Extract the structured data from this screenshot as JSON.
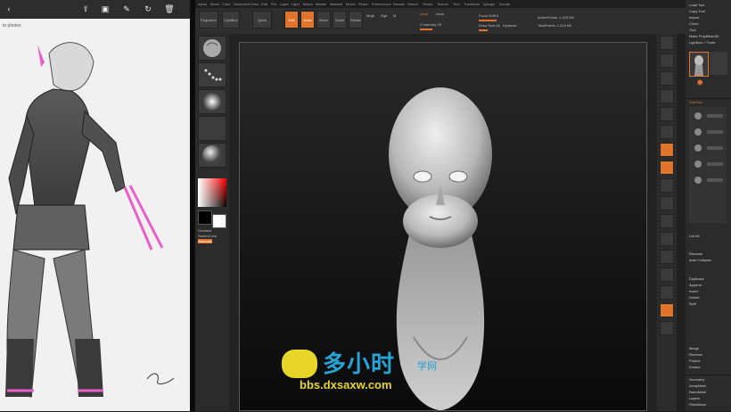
{
  "viewer": {
    "title": "to photos",
    "icons": [
      "back-icon",
      "share-icon",
      "slideshow-icon",
      "edit-icon",
      "rotate-icon",
      "delete-icon"
    ]
  },
  "zbrush": {
    "menu": [
      "Alpha",
      "Brush",
      "Color",
      "Document",
      "Draw",
      "Edit",
      "File",
      "Layer",
      "Light",
      "Macro",
      "Marker",
      "Material",
      "Movie",
      "Picker",
      "Preferences",
      "Render",
      "Stencil",
      "Stroke",
      "Texture",
      "Tool",
      "Transform",
      "Zplugin",
      "Zscript"
    ],
    "top_buttons": [
      "Projection Master",
      "LightBox",
      "Quick Sketch",
      "Edit",
      "Draw",
      "Move",
      "Scale",
      "Rotate"
    ],
    "mrgb": "Mrgb",
    "rgb": "Rgb",
    "m": "M",
    "zadd": "Zadd",
    "zsub": "Zsub",
    "z_intensity": "Z Intensity 25",
    "focal_shift": "Focal Shift 0",
    "draw_size": "Draw Size 64",
    "dynamic": "Dynamic",
    "active_points": "ActivePoints: 1,023 Mil",
    "total_points": "TotalPoints: 1,023 Mil",
    "left_tray": {
      "gradient": "Gradient",
      "switch_color": "SwitchColor",
      "alternate": "Alternate"
    },
    "right_tray": [
      "BPR",
      "SPix 3",
      "Scroll",
      "Zoom",
      "Actual",
      "AAHalf",
      "Persp",
      "Floor",
      "Local",
      "L.Sym",
      "XYZ",
      "Frame",
      "Move",
      "Scale",
      "Rotate",
      "Line Fill",
      "PolyF",
      "Transp",
      "Ghost",
      "Solo",
      "Xpose"
    ]
  },
  "tool_panel": {
    "items": [
      "Load Tool",
      "Copy Tool",
      "Import",
      "Clone",
      "GoZ",
      "R",
      "Make PolyMesh3D",
      "Lightbox > Tools",
      "SubTool",
      "List All",
      "Rename",
      "Auto Collapse",
      "Duplicate",
      "Append",
      "Insert",
      "Delete",
      "Del Other",
      "Split",
      "Merge",
      "Remesh",
      "Project",
      "Extract",
      "Geometry",
      "ArrayMesh",
      "NanoMesh",
      "Layers",
      "FiberMesh"
    ]
  },
  "watermark": {
    "cn": "多小时",
    "cn2": "学网",
    "url": "bbs.dxsaxw.com"
  }
}
